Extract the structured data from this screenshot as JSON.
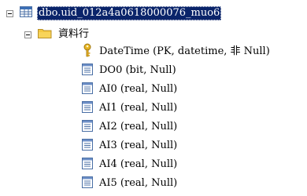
{
  "tree": {
    "table": {
      "label": "dbo.uid_012a4a0618000076_muo6",
      "icon": "table-icon",
      "expanded": true
    },
    "folder": {
      "label": "資料行",
      "icon": "folder-icon",
      "expanded": true
    },
    "columns": [
      {
        "label": "DateTime (PK, datetime, 非 Null)",
        "icon": "primary-key-icon"
      },
      {
        "label": "DO0 (bit, Null)",
        "icon": "column-icon"
      },
      {
        "label": "AI0 (real, Null)",
        "icon": "column-icon"
      },
      {
        "label": "AI1 (real, Null)",
        "icon": "column-icon"
      },
      {
        "label": "AI2 (real, Null)",
        "icon": "column-icon"
      },
      {
        "label": "AI3 (real, Null)",
        "icon": "column-icon"
      },
      {
        "label": "AI4 (real, Null)",
        "icon": "column-icon"
      },
      {
        "label": "AI5 (real, Null)",
        "icon": "column-icon"
      }
    ]
  },
  "colors": {
    "selection": "#0a246a",
    "folder": "#f4c842",
    "key": "#d9a520",
    "tableHeader": "#3b6fb6"
  }
}
